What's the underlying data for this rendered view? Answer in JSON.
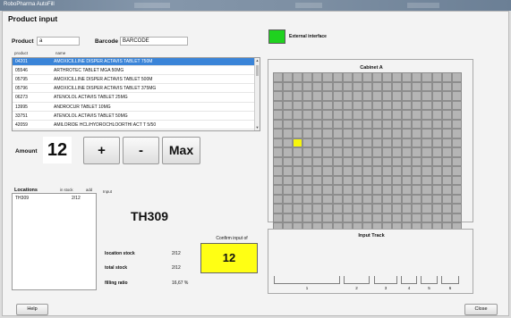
{
  "window": {
    "title": "RoboPharma AutoFill"
  },
  "header": {
    "title": "Product input"
  },
  "search": {
    "product_label": "Product",
    "product_value": "a",
    "barcode_label": "Barcode",
    "barcode_value": "BARCODE"
  },
  "product_list": {
    "columns": [
      "product",
      "name"
    ],
    "rows": [
      {
        "code": "04201",
        "name": "AMOXICILLINE DISPER ACTAVIS TABLET 750M",
        "selected": true
      },
      {
        "code": "05546",
        "name": "ARTHROTEC TABLET MGA 50MG",
        "selected": false
      },
      {
        "code": "05795",
        "name": "AMOXICILLINE DISPER ACTAVIS TABLET 500M",
        "selected": false
      },
      {
        "code": "05796",
        "name": "AMOXICILLINE DISPER ACTAVIS TABLET 375MG",
        "selected": false
      },
      {
        "code": "06273",
        "name": "ATENOLOL ACTAVIS TABLET 25MG",
        "selected": false
      },
      {
        "code": "13995",
        "name": "ANDROCUR TABLET 10MG",
        "selected": false
      },
      {
        "code": "33751",
        "name": "ATENOLOL ACTAVIS TABLET 50MG",
        "selected": false
      },
      {
        "code": "42059",
        "name": "AMILORIDE HCL/HYDROCHLOORTHI ACT T 5/50",
        "selected": false
      }
    ]
  },
  "amount": {
    "label": "Amount",
    "value": "12",
    "plus_label": "+",
    "minus_label": "-",
    "max_label": "Max"
  },
  "locations": {
    "label": "Locations",
    "col_stock": "in stock",
    "col_add": "add",
    "rows": [
      {
        "name": "TH309",
        "stock": "2/12"
      }
    ]
  },
  "input_panel": {
    "label": "Input",
    "location": "TH309",
    "location_stock_label": "location stock",
    "location_stock_value": "2/12",
    "total_stock_label": "total stock",
    "total_stock_value": "2/12",
    "filling_ratio_label": "filling ratio",
    "filling_ratio_value": "16,67 %",
    "confirm_label": "Confirm input of",
    "confirm_value": "12"
  },
  "external": {
    "label": "External interface",
    "status_color": "#1fd21f"
  },
  "cabinet": {
    "title": "Cabinet A",
    "rows": 19,
    "cols": 19,
    "highlight_row": 7,
    "highlight_col": 2,
    "highlight_color": "#f7f70c"
  },
  "input_track": {
    "title": "Input Track",
    "slots": [
      "1",
      "2",
      "3",
      "4",
      "5",
      "6"
    ]
  },
  "footer": {
    "help_label": "Help",
    "close_label": "Close"
  }
}
